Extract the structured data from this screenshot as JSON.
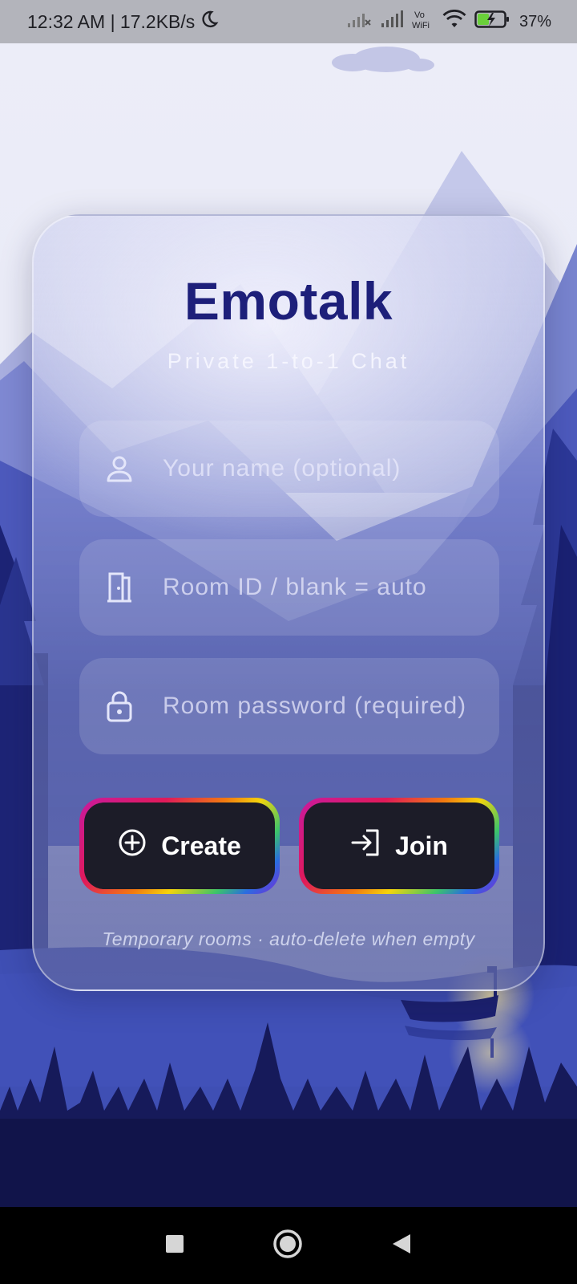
{
  "status_bar": {
    "time_speed": "12:32 AM | 17.2KB/s",
    "battery_pct": "37%",
    "icons": [
      "moon-icon",
      "signal-off-icon",
      "signal-icon",
      "vowifi-icon",
      "wifi-icon",
      "battery-charging-icon"
    ]
  },
  "app": {
    "title": "Emotalk",
    "subtitle": "Private 1-to-1 Chat",
    "fields": [
      {
        "icon": "person-icon",
        "placeholder": "Your name (optional)",
        "value": ""
      },
      {
        "icon": "door-icon",
        "placeholder": "Room ID / blank = auto",
        "value": ""
      },
      {
        "icon": "lock-icon",
        "placeholder": "Room password (required)",
        "value": ""
      }
    ],
    "buttons": {
      "create": {
        "label": "Create",
        "icon": "plus-circle-icon"
      },
      "join": {
        "label": "Join",
        "icon": "login-arrow-icon"
      }
    },
    "hint": "Temporary rooms · auto-delete when empty"
  },
  "nav_bar": {
    "icons": [
      "recents-square-icon",
      "home-circle-icon",
      "back-triangle-icon"
    ]
  },
  "colors": {
    "title": "#1d1f7a",
    "button_bg": "#1c1c28",
    "sky": "#e6e8f6",
    "lake": "#3f4fb4",
    "forest": "#131650"
  }
}
